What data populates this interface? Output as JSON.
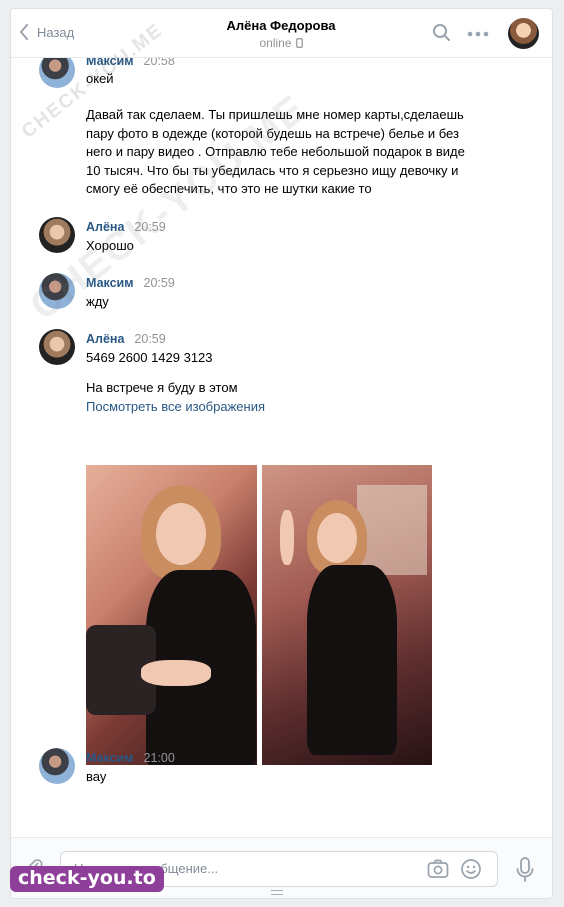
{
  "header": {
    "back_label": "Назад",
    "contact_name": "Алёна Федорова",
    "contact_status": "online"
  },
  "messages": [
    {
      "sender": "Максим",
      "time": "20:58",
      "lines": [
        "окей"
      ]
    },
    {
      "sender": "",
      "time": "",
      "lines": [
        "Давай так сделаем. Ты пришлешь мне номер карты,сделаешь",
        "пару фото в одежде (которой будешь на встрече) белье и без",
        "него и пару видео . Отправлю тебе небольшой подарок в виде",
        "10 тысяч. Что бы ты убедилась что я серьезно ищу девочку и",
        "смогу её обеспечить, что это не шутки какие то"
      ]
    },
    {
      "sender": "Алёна",
      "time": "20:59",
      "lines": [
        "Хорошо"
      ]
    },
    {
      "sender": "Максим",
      "time": "20:59",
      "lines": [
        "жду"
      ]
    },
    {
      "sender": "Алёна",
      "time": "20:59",
      "lines": [
        "5469 2600 1429 3123"
      ]
    },
    {
      "sender": "",
      "time": "",
      "lines": [
        "На встрече я буду в этом"
      ],
      "link": "Посмотреть все изображения"
    },
    {
      "sender": "Максим",
      "time": "21:00",
      "lines": [
        "вау"
      ]
    }
  ],
  "composer": {
    "placeholder": "Напишите сообщение..."
  },
  "watermark": {
    "domain_large": "CHECK-YOU.ME",
    "domain_small": "CHECK-YOU.ME",
    "logo": "check-you.to"
  },
  "icons": {
    "back": "chevron-left-icon",
    "search": "search-icon",
    "more": "more-horizontal-icon",
    "phone": "mobile-phone-icon",
    "attach": "paperclip-icon",
    "camera": "camera-icon",
    "emoji": "smile-icon",
    "mic": "microphone-icon"
  },
  "colors": {
    "accent": "#2a5885",
    "muted": "#939393",
    "logo_bg": "#8e3f9a"
  }
}
